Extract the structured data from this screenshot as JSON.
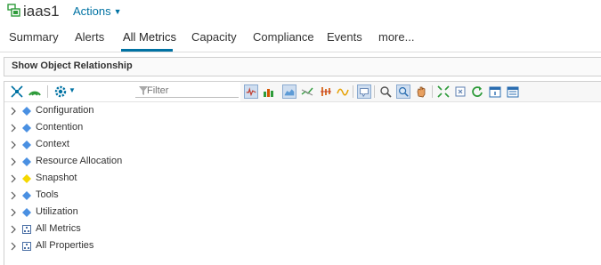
{
  "header": {
    "title": "iaas1",
    "actions_label": "Actions"
  },
  "tabs": [
    {
      "label": "Summary"
    },
    {
      "label": "Alerts"
    },
    {
      "label": "All Metrics"
    },
    {
      "label": "Capacity"
    },
    {
      "label": "Compliance"
    },
    {
      "label": "Events"
    },
    {
      "label": "more..."
    }
  ],
  "active_tab": "All Metrics",
  "relationship_bar": {
    "label": "Show Object Relationship"
  },
  "filter": {
    "placeholder": "Filter"
  },
  "tree": {
    "items": [
      {
        "label": "Configuration",
        "icon": "diamond-icon"
      },
      {
        "label": "Contention",
        "icon": "diamond-icon"
      },
      {
        "label": "Context",
        "icon": "diamond-icon"
      },
      {
        "label": "Resource Allocation",
        "icon": "diamond-icon"
      },
      {
        "label": "Snapshot",
        "icon": "yellow-diamond-icon"
      },
      {
        "label": "Tools",
        "icon": "diamond-icon"
      },
      {
        "label": "Utilization",
        "icon": "diamond-icon"
      },
      {
        "label": "All Metrics",
        "icon": "hierarchy-icon"
      },
      {
        "label": "All Properties",
        "icon": "hierarchy-icon"
      }
    ]
  },
  "colors": {
    "link": "#0072a3",
    "diamond": "#4a90e2",
    "snapshot_diamond": "#f5d800",
    "green_icon": "#2e9b3a"
  }
}
